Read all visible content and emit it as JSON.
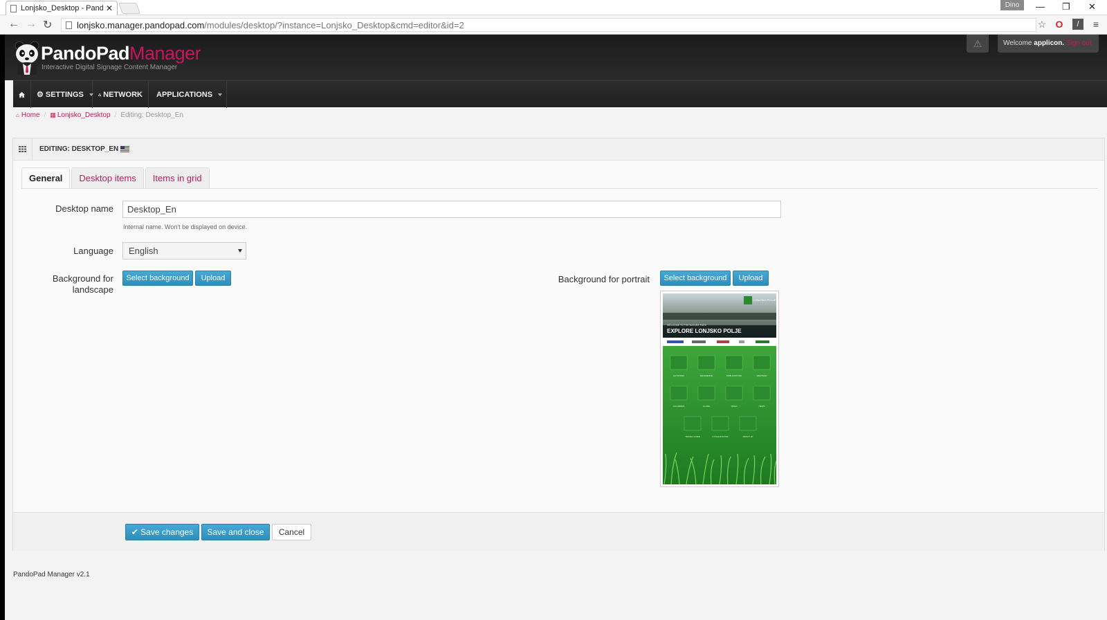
{
  "browser": {
    "tab_title": "Lonjsko_Desktop - PandoPad",
    "profile": "Dino",
    "url_host": "lonjsko.manager.pandopad.com",
    "url_path": "/modules/desktop/?instance=Lonjsko_Desktop&cmd=editor&id=2"
  },
  "header": {
    "brand_main": "PandoPad",
    "brand_accent": "Manager",
    "tagline": "Interactive Digital Signage Content Manager",
    "welcome_prefix": "Welcome",
    "user": "applicon.",
    "sign_out": "Sign out"
  },
  "nav": {
    "settings": "SETTINGS",
    "network": "NETWORK",
    "applications": "APPLICATIONS"
  },
  "breadcrumb": {
    "home": "Home",
    "instance": "Lonjsko_Desktop",
    "current": "Editing: Desktop_En"
  },
  "panel": {
    "title": "EDITING: DESKTOP_EN",
    "tabs": [
      "General",
      "Desktop items",
      "Items in grid"
    ]
  },
  "form": {
    "desktop_name_label": "Desktop name",
    "desktop_name_value": "Desktop_En",
    "desktop_name_help": "Internal name. Won't be displayed on device.",
    "language_label": "Language",
    "language_value": "English",
    "bg_landscape_label": "Background for landscape",
    "bg_portrait_label": "Background for portrait",
    "select_background": "Select background",
    "upload": "Upload"
  },
  "preview": {
    "heading": "EXPLORE LONJSKO POLJE",
    "logo": "LONJSKO POLJE",
    "sub": "WELCOME TO THE NATURE PARK",
    "tile_labels": [
      "ACTIVITIES",
      "REFERENCE",
      "PUBLICATIONS",
      "WEATHER",
      "GALLERIES",
      "GLADE",
      "VIDEO",
      "NEWS",
      "TRAVEL GUIDE",
      "CYCLE ROUTES",
      "ABOUT LP"
    ]
  },
  "footer_buttons": {
    "save_changes": "Save changes",
    "save_close": "Save and close",
    "cancel": "Cancel"
  },
  "version": "PandoPad Manager v2.1",
  "colors": {
    "accent": "#c2185b",
    "primary_button": "#3a9dc9",
    "header_bg": "#1f1f1f"
  }
}
